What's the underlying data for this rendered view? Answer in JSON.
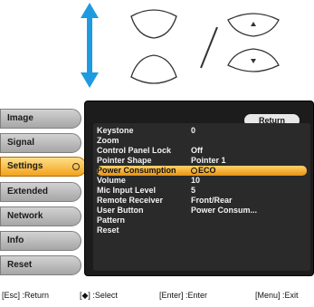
{
  "tabs": [
    {
      "label": "Image",
      "active": false
    },
    {
      "label": "Signal",
      "active": false
    },
    {
      "label": "Settings",
      "active": true
    },
    {
      "label": "Extended",
      "active": false
    },
    {
      "label": "Network",
      "active": false
    },
    {
      "label": "Info",
      "active": false
    },
    {
      "label": "Reset",
      "active": false
    }
  ],
  "panel": {
    "return_label": "Return",
    "rows": [
      {
        "label": "Keystone",
        "value": "0"
      },
      {
        "label": "Zoom",
        "value": ""
      },
      {
        "label": "Control Panel Lock",
        "value": "Off"
      },
      {
        "label": "Pointer Shape",
        "value": "Pointer 1"
      },
      {
        "label": "Power Consumption",
        "value": "ECO",
        "selected": true
      },
      {
        "label": "Volume",
        "value": "10"
      },
      {
        "label": "Mic Input Level",
        "value": "5"
      },
      {
        "label": "Remote Receiver",
        "value": "Front/Rear"
      },
      {
        "label": "User Button",
        "value": "Power Consum..."
      },
      {
        "label": "Pattern",
        "value": ""
      },
      {
        "label": "Reset",
        "value": ""
      }
    ]
  },
  "footer": {
    "esc": "[Esc] :Return",
    "select": "[◆] :Select",
    "enter": "[Enter] :Enter",
    "menu": "[Menu] :Exit"
  },
  "colors": {
    "active_tab": "#f2a21c",
    "arrow": "#1e9be0",
    "panel_bg": "#1c1c1c"
  }
}
